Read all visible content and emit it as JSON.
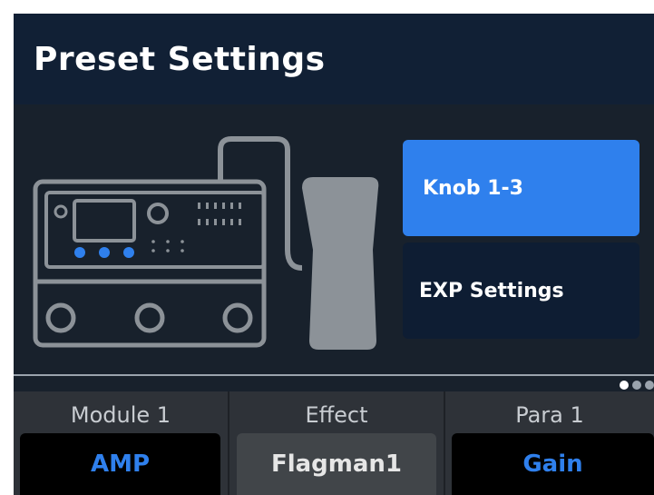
{
  "header": {
    "title": "Preset Settings"
  },
  "menu": [
    {
      "label": "Knob 1-3",
      "active": true
    },
    {
      "label": "EXP Settings",
      "active": false
    }
  ],
  "pagination": {
    "pages": 3,
    "current": 1
  },
  "params": [
    {
      "label": "Module 1",
      "value": "AMP"
    },
    {
      "label": "Effect",
      "value": "Flagman1"
    },
    {
      "label": "Para 1",
      "value": "Gain"
    }
  ],
  "colors": {
    "accent": "#2f80ed",
    "background": "#18212c",
    "header": "#112035",
    "device_outline": "#8c9298"
  }
}
